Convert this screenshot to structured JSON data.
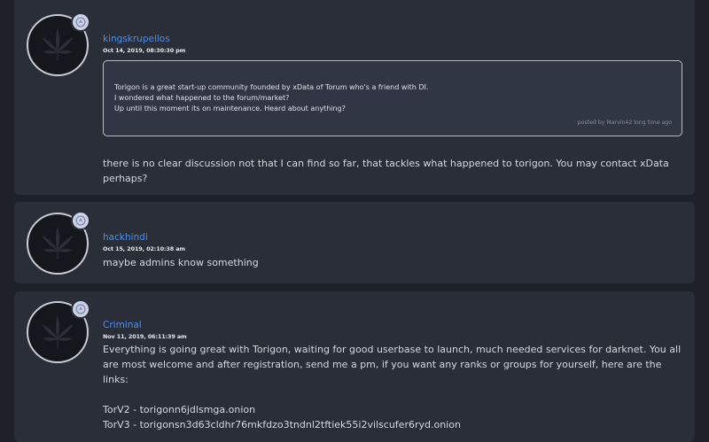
{
  "posts": [
    {
      "username": "kingskrupellos",
      "timestamp": "Oct 14, 2019, 08:30:30 pm",
      "quote": {
        "lines": [
          "Torigon is a great start-up community founded by xData of Torum who's a friend with DI.",
          "I wondered what happened to the forum/market?",
          "Up until this moment its on maintenance. Heard about anything?"
        ],
        "meta": "posted by Marvin42 long time ago"
      },
      "body": [
        "there is no clear discussion not that I can find so far, that tackles what happened to torigon. You may contact xData",
        "perhaps?"
      ]
    },
    {
      "username": "hackhindi",
      "timestamp": "Oct 15, 2019, 02:10:38 am",
      "body": [
        "maybe admins know something"
      ]
    },
    {
      "username": "Criminal",
      "timestamp": "Nov 11, 2019, 06:11:39 am",
      "body": [
        "Everything is going great with Torigon, waiting for good userbase to launch, much needed services for darknet. You all",
        "are most welcome and after registration, send me a pm, if you want any ranks or groups for yourself, here are the links:"
      ],
      "links": [
        "TorV2 - torigonn6jdlsmga.onion",
        "TorV3 - torigonsn3d63cldhr76mkfdzo3tndnl2tftiek55i2vilscufer6ryd.onion"
      ]
    }
  ],
  "icons": {
    "avatar": "cannabis-leaf-icon",
    "badge": "rank-badge-icon"
  },
  "colors": {
    "background": "#1e212a",
    "card": "#2a2e39",
    "username": "#4a8ff0",
    "text": "#d5d8df"
  }
}
